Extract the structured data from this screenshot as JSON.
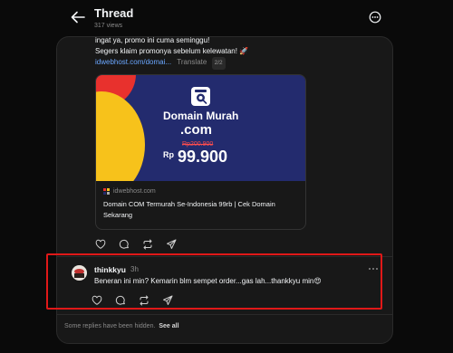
{
  "header": {
    "title": "Thread",
    "views": "317 views"
  },
  "post": {
    "lines": [
      "ingat ya, promo ini cuma seminggu!",
      "Segers klaim promonya sebelum kelewatan! 🚀"
    ],
    "link": "idwebhost.com/domai...",
    "translate": "Translate",
    "translate_badge": "2/2",
    "card": {
      "banner_title": "Domain Murah",
      "banner_ext": ".com",
      "old_price": "Rp200.900",
      "currency": "Rp",
      "new_price": "99.900",
      "domain": "idwebhost.com",
      "title": "Domain COM Termurah Se-Indonesia 99rb | Cek Domain Sekarang"
    }
  },
  "reply": {
    "username": "thinkkyu",
    "time": "3h",
    "text": "Beneran ini min? Kemarin blm sempet order...gas lah...thankkyu min😍"
  },
  "footer": {
    "hidden_note": "Some replies have been hidden.",
    "see_all": "See all"
  },
  "colors": {
    "background": "#0a0a0a",
    "panel": "#181818",
    "link": "#6aa7ff",
    "highlight": "#e01818",
    "banner": "#232b6e"
  }
}
